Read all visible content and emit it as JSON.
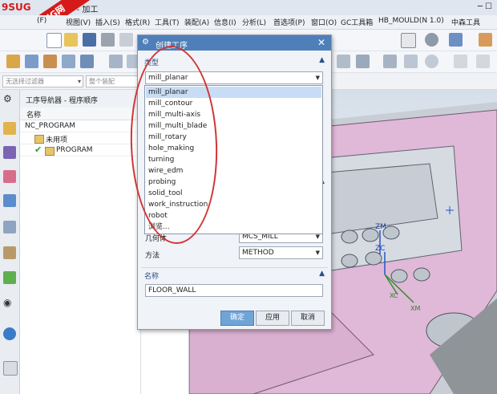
{
  "window": {
    "title": "7 - 加工",
    "watermark_logo": "9SUG",
    "watermark_band": "学UG就上UG网"
  },
  "menu": [
    "(F)",
    "视图(V)",
    "插入(S)",
    "格式(R)",
    "工具(T)",
    "装配(A)",
    "信息(I)",
    "分析(L)",
    "首选项(P)",
    "窗口(O)",
    "GC工具箱",
    "HB_MOULD(N 1.0)",
    "中森工具"
  ],
  "filter": {
    "selection_filter": "无选择过滤器",
    "scope": "整个装配"
  },
  "navigator": {
    "title": "工序导航器 - 程序顺序",
    "column_name": "名称",
    "rows": [
      "NC_PROGRAM",
      "未用项",
      "PROGRAM"
    ]
  },
  "dialog": {
    "title": "创建工序",
    "close_label": "✕",
    "type_section": "类型",
    "type_value": "mill_planar",
    "type_options": [
      "mill_planar",
      "mill_contour",
      "mill_multi-axis",
      "mill_multi_blade",
      "mill_rotary",
      "hole_making",
      "turning",
      "wire_edm",
      "probing",
      "solid_tool",
      "work_instruction",
      "robot",
      "浏览..."
    ],
    "geometry_label": "几何体",
    "geometry_value": "MCS_MILL",
    "method_label": "方法",
    "method_value": "METHOD",
    "name_section": "名称",
    "name_value": "FLOOR_WALL",
    "ok_label": "确定",
    "apply_label": "应用",
    "cancel_label": "取消"
  },
  "axes": {
    "zm": "ZM",
    "zc": "ZC",
    "xc": "XC",
    "xm": "XM"
  },
  "colors": {
    "dialog_title": "#4f7fb8",
    "selected_option": "#c7ddf5",
    "annotation_circle": "#d23434",
    "part_face": "#e0b8d8"
  }
}
